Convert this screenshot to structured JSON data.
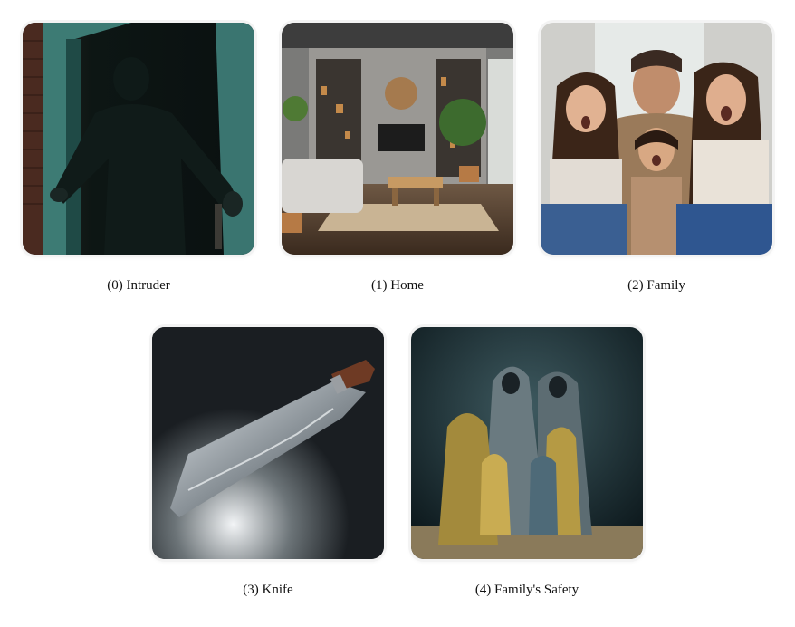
{
  "gallery": {
    "items": [
      {
        "caption": "(0) Intruder",
        "image": "intruder-image"
      },
      {
        "caption": "(1) Home",
        "image": "home-image"
      },
      {
        "caption": "(2) Family",
        "image": "family-image"
      },
      {
        "caption": "(3) Knife",
        "image": "knife-image"
      },
      {
        "caption": "(4) Family's Safety",
        "image": "family-safety-image"
      }
    ]
  }
}
